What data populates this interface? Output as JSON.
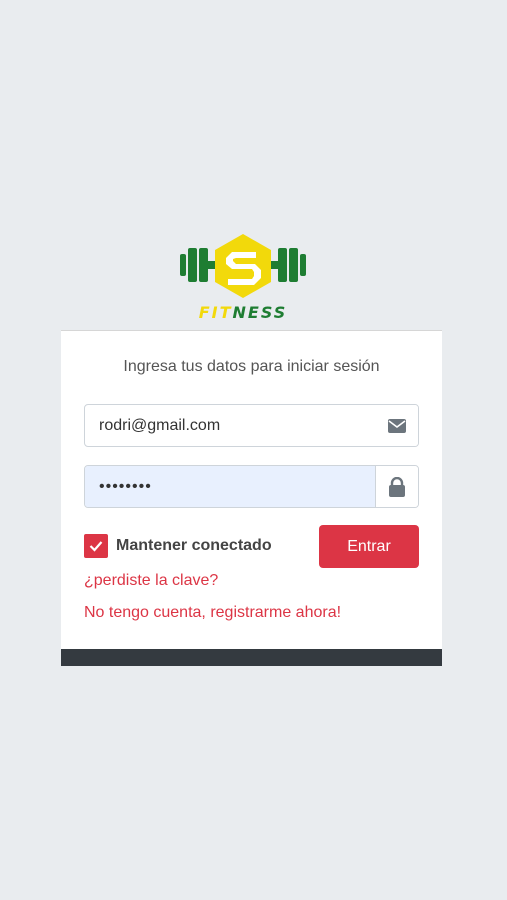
{
  "brand": {
    "fit": "FIT",
    "ness": "NESS",
    "colors": {
      "yellow": "#f2d90b",
      "green": "#1e7d32"
    }
  },
  "login": {
    "title": "Ingresa tus datos para iniciar sesión",
    "email_value": "rodri@gmail.com",
    "password_value": "••••••••",
    "email_icon": "envelope-icon",
    "password_icon": "lock-icon",
    "remember_label": "Mantener conectado",
    "remember_checked": true,
    "submit_label": "Entrar",
    "forgot_link": "¿perdiste la clave?",
    "register_link": "No tengo cuenta, registrarme ahora!"
  },
  "colors": {
    "accent": "#dc3545",
    "background": "#e9ecef",
    "footer": "#343a40"
  }
}
